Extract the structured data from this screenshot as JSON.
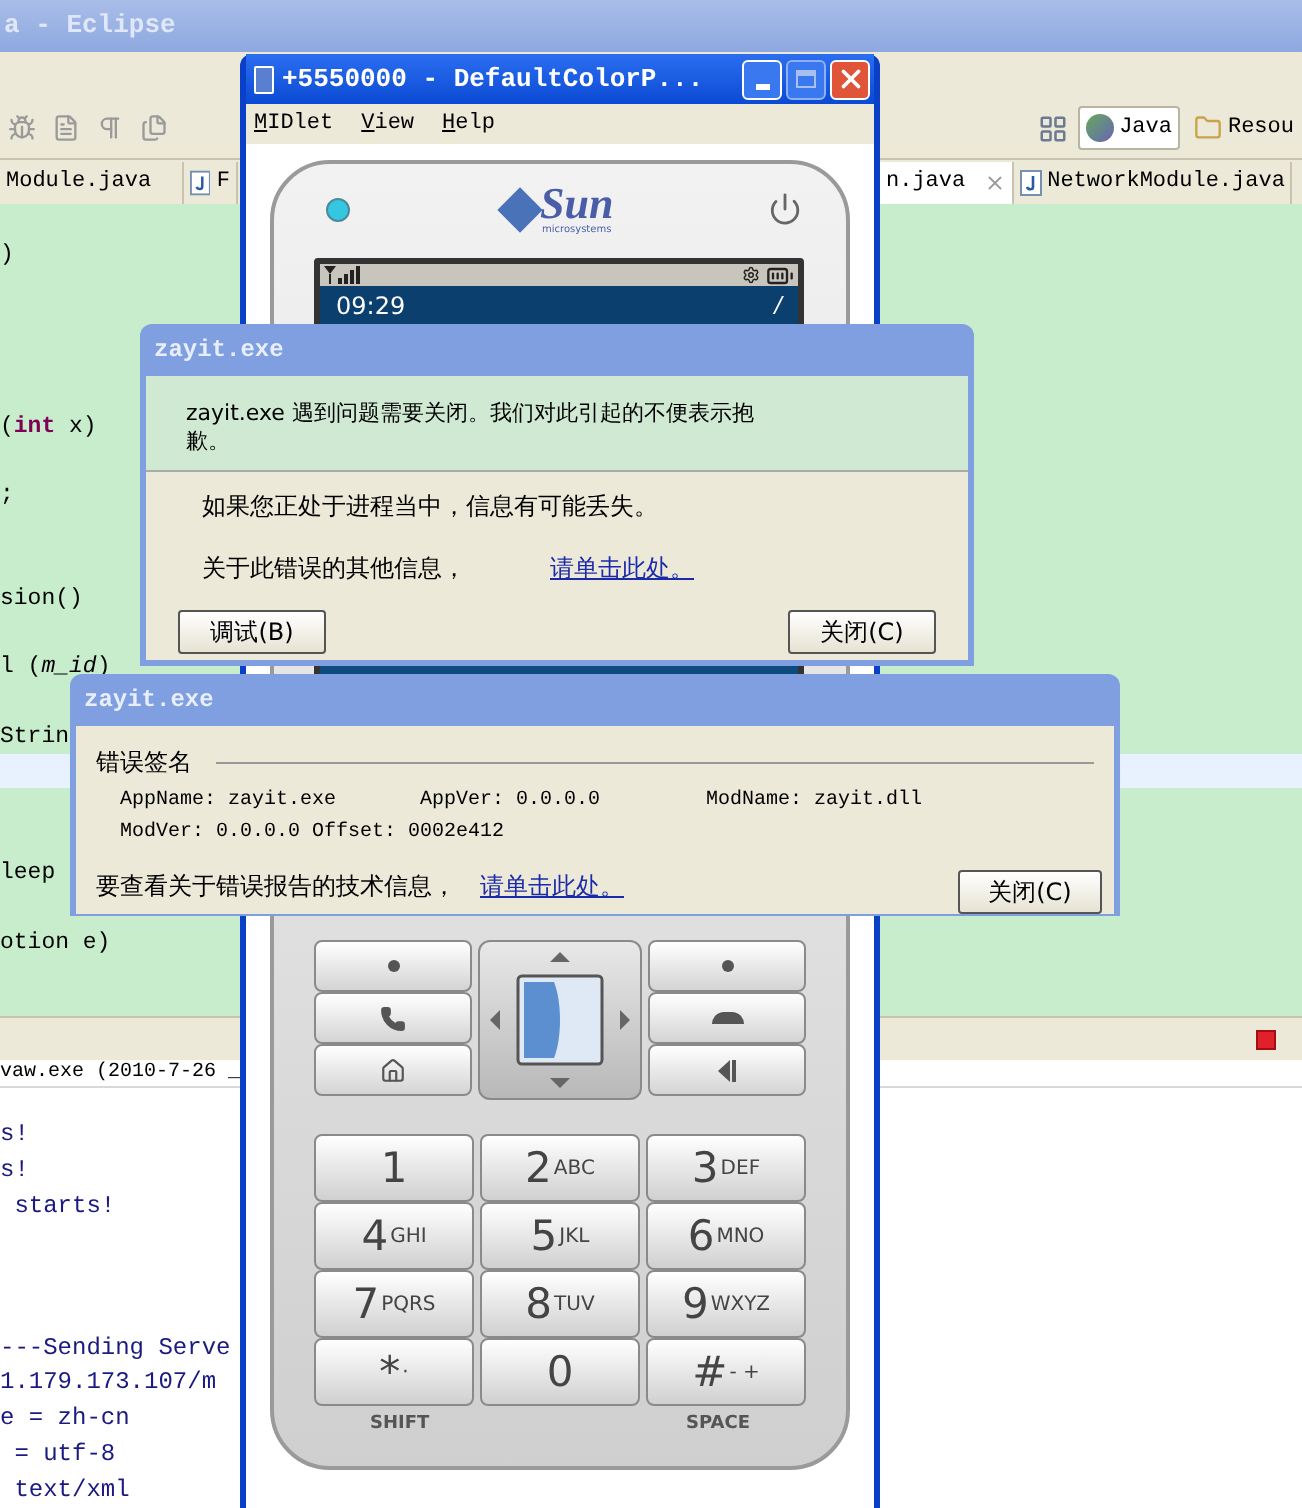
{
  "eclipse": {
    "title": "a - Eclipse",
    "perspectives": [
      {
        "label": "Java",
        "selected": true
      },
      {
        "label": "Resou",
        "selected": false
      }
    ],
    "editor_tabs": [
      {
        "label": "Module.java",
        "selected": false
      },
      {
        "label": "F",
        "selected": false
      },
      {
        "label": "n.java",
        "selected": true
      },
      {
        "label": "NetworkModule.java",
        "selected": false
      }
    ],
    "code_lines": [
      ")",
      "(**int** x)",
      ";",
      "sion()",
      "l (*m_id*)",
      "Strin",
      "leep",
      "otion e)"
    ],
    "console_title": "vaw.exe (2010-7-26 _",
    "console_lines": [
      "s!",
      "s!",
      " starts!",
      "---Sending Serve",
      "1.179.173.107/m",
      "e = zh-cn",
      " = utf-8",
      " text/xml"
    ]
  },
  "emulator": {
    "title": "+5550000 - DefaultColorP...",
    "menu": [
      "MIDlet",
      "View",
      "Help"
    ],
    "logo": "Sun",
    "logo_sub": "microsystems",
    "clock": "09:29",
    "indicator": "/",
    "keypad": [
      {
        "digit": "1"
      },
      {
        "digit": "2",
        "letters": "ABC"
      },
      {
        "digit": "3",
        "letters": "DEF"
      },
      {
        "digit": "4",
        "letters": "GHI"
      },
      {
        "digit": "5",
        "letters": "JKL"
      },
      {
        "digit": "6",
        "letters": "MNO"
      },
      {
        "digit": "7",
        "letters": "PQRS"
      },
      {
        "digit": "8",
        "letters": "TUV"
      },
      {
        "digit": "9",
        "letters": "WXYZ"
      },
      {
        "digit": "*",
        "letters": "·"
      },
      {
        "digit": "0"
      },
      {
        "digit": "#",
        "letters": "- +"
      }
    ],
    "key_labels": [
      "SHIFT",
      "SPACE"
    ]
  },
  "error_dialog": {
    "title": "zayit.exe",
    "message": "zayit.exe 遇到问题需要关闭。我们对此引起的不便表示抱歉。",
    "note": "如果您正处于进程当中，信息有可能丢失。",
    "info_label": "关于此错误的其他信息，",
    "link": "请单击此处。",
    "buttons": [
      "调试(B)",
      "关闭(C)"
    ]
  },
  "details_dialog": {
    "title": "zayit.exe",
    "section": "错误签名",
    "signature": [
      "AppName: zayit.exe",
      "AppVer: 0.0.0.0",
      "ModName: zayit.dll",
      "ModVer: 0.0.0.0",
      "Offset: 0002e412"
    ],
    "info_label": "要查看关于错误报告的技术信息，",
    "link": "请单击此处。",
    "button": "关闭(C)"
  }
}
